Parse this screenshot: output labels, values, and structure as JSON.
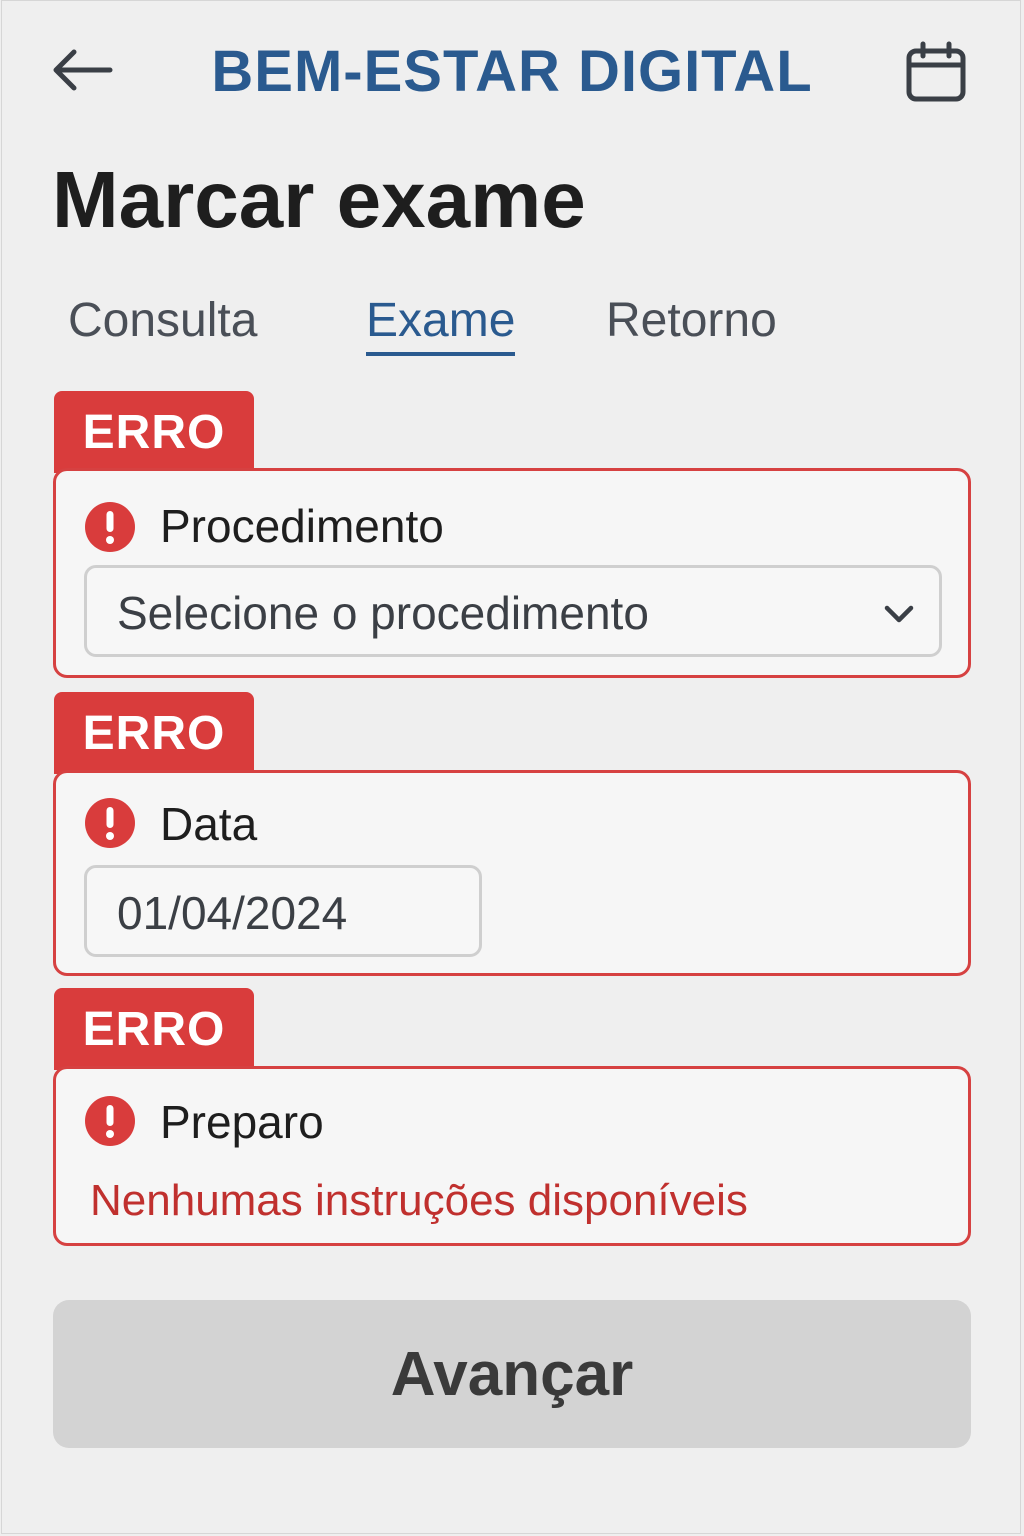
{
  "header": {
    "app_title": "BEM-ESTAR DIGITAL",
    "back_icon": "arrow-left-icon",
    "calendar_icon": "calendar-icon"
  },
  "page": {
    "title": "Marcar exame"
  },
  "tabs": [
    {
      "label": "Consulta",
      "active": false
    },
    {
      "label": "Exame",
      "active": true
    },
    {
      "label": "Retorno",
      "active": false
    }
  ],
  "fields": {
    "procedimento": {
      "badge": "ERRO",
      "label": "Procedimento",
      "placeholder": "Selecione o procedimento"
    },
    "data": {
      "badge": "ERRO",
      "label": "Data",
      "value": "01/04/2024"
    },
    "preparo": {
      "badge": "ERRO",
      "label": "Preparo",
      "message": "Nenhumas instruções disponíveis"
    }
  },
  "actions": {
    "next_label": "Avançar",
    "next_enabled": false
  },
  "colors": {
    "brand": "#2a5a8f",
    "error": "#d93c3c",
    "error_text": "#c0302e",
    "disabled_button": "#d3d3d3"
  }
}
